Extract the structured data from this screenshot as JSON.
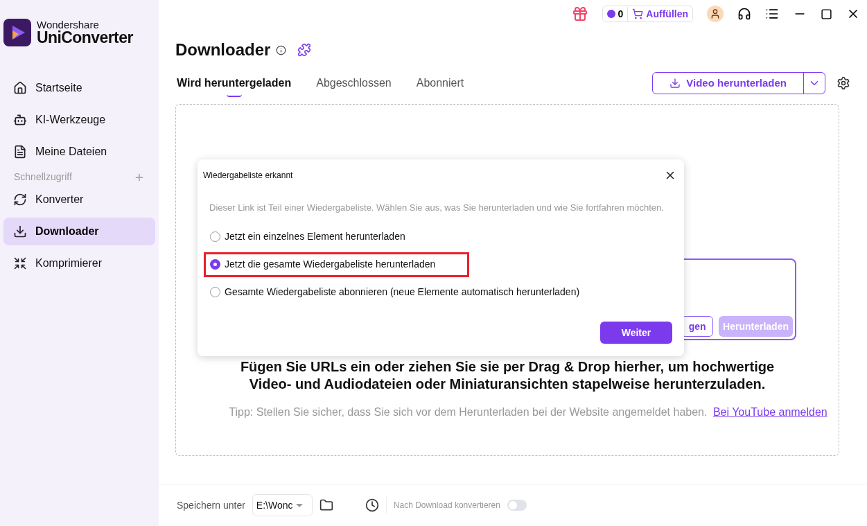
{
  "app": {
    "brand_top": "Wondershare",
    "brand_name": "UniConverter"
  },
  "sidebar": {
    "items": [
      {
        "label": "Startseite",
        "selected": false
      },
      {
        "label": "KI-Werkzeuge",
        "selected": false
      },
      {
        "label": "Meine Dateien",
        "selected": false
      }
    ],
    "section": "Schnellzugriff",
    "quick_items": [
      {
        "label": "Konverter",
        "selected": false
      },
      {
        "label": "Downloader",
        "selected": true
      },
      {
        "label": "Komprimierer",
        "selected": false
      }
    ]
  },
  "top_bar": {
    "credits": "0",
    "refill": "Auffüllen"
  },
  "page": {
    "title": "Downloader",
    "tabs": [
      {
        "label": "Wird heruntergeladen",
        "selected": true
      },
      {
        "label": "Abgeschlossen",
        "selected": false
      },
      {
        "label": "Abonniert",
        "selected": false
      }
    ],
    "download_button": "Video herunterladen"
  },
  "drop_zone": {
    "card_buttons": [
      {
        "label": "gen",
        "kind": "outline"
      },
      {
        "label": "Herunterladen",
        "kind": "disabled"
      }
    ],
    "headline": "Fügen Sie URLs ein oder ziehen Sie sie per Drag & Drop hierher, um hochwertige Video- und Audiodateien oder Miniaturansichten stapelweise herunterzuladen.",
    "tip": "Tipp: Stellen Sie sicher, dass Sie sich vor dem Herunterladen bei der Website angemeldet haben.",
    "tip_link": "Bei YouTube anmelden"
  },
  "bottom_bar": {
    "save_label": "Speichern unter",
    "path": "E:\\Wonc",
    "convert_label": "Nach Download konvertieren",
    "convert_on": false
  },
  "dialog": {
    "title": "Wiedergabeliste erkannt",
    "message": "Dieser Link ist Teil einer Wiedergabeliste. Wählen Sie aus, was Sie herunterladen und wie Sie fortfahren möchten.",
    "options": [
      {
        "label": "Jetzt ein einzelnes Element herunterladen",
        "selected": false,
        "highlighted": false
      },
      {
        "label": "Jetzt die gesamte Wiedergabeliste herunterladen",
        "selected": true,
        "highlighted": true
      },
      {
        "label": "Gesamte Wiedergabeliste abonnieren (neue Elemente automatisch herunterladen)",
        "selected": false,
        "highlighted": false
      }
    ],
    "confirm": "Weiter"
  }
}
